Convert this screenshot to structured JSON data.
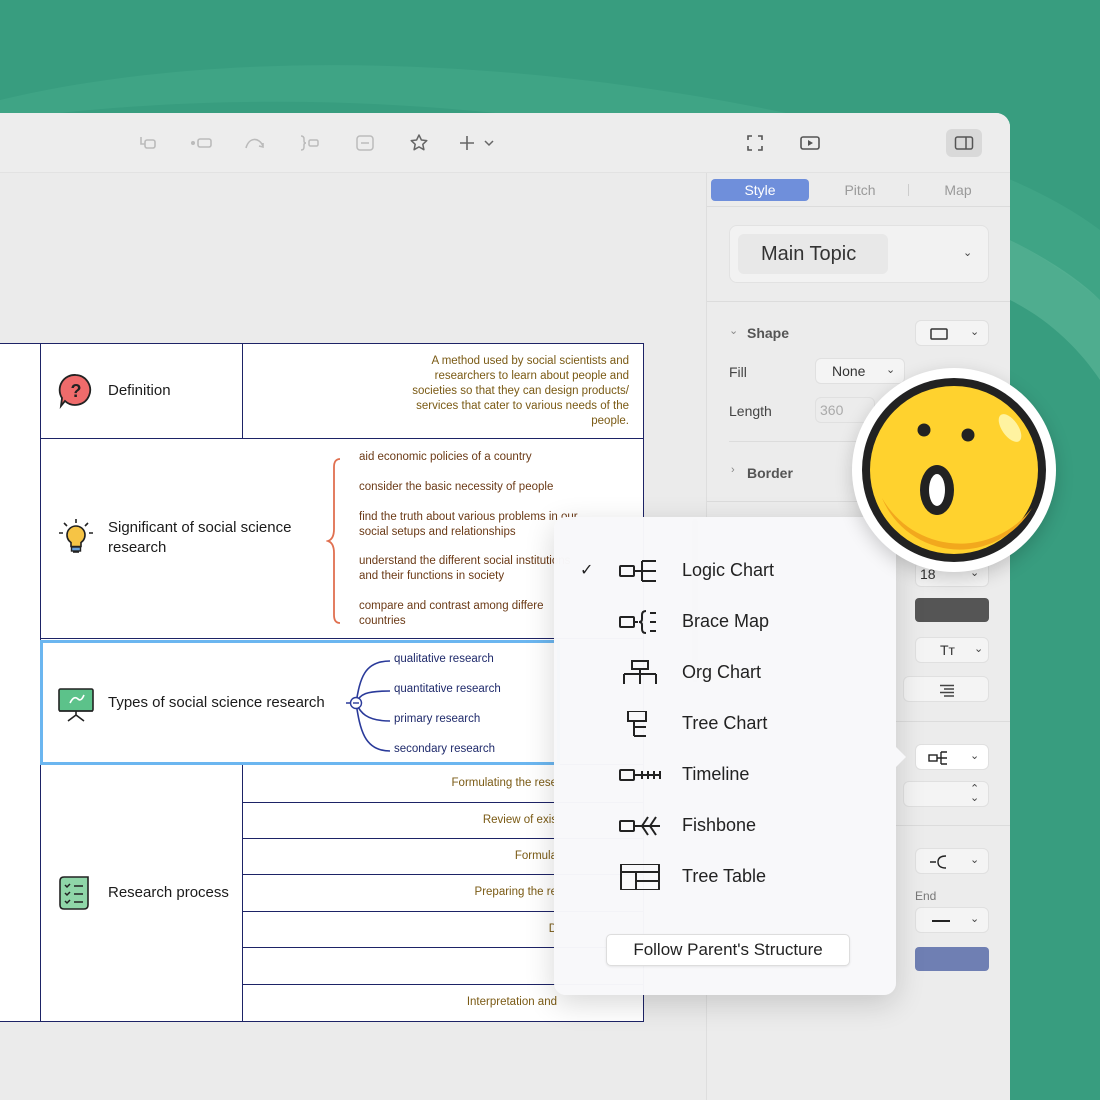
{
  "toolbar": {
    "icons": [
      "topic-icon",
      "subtopic-icon",
      "relationship-icon",
      "summary-icon",
      "boundary-icon",
      "star-icon",
      "add-icon",
      "fullscreen-icon",
      "play-icon",
      "panel-toggle-icon"
    ]
  },
  "table": {
    "rows": [
      {
        "label": "Definition",
        "note": [
          "A method used by social scientists and",
          "researchers to learn about people and",
          "societies so that they can design products/",
          "services that cater to various needs of the",
          "people."
        ]
      },
      {
        "label_lines": [
          "Significant of social science",
          "research"
        ],
        "branches": [
          [
            "aid economic policies of a country"
          ],
          [
            "consider the basic necessity of people"
          ],
          [
            "find the truth about various problems in our",
            "social setups and relationships"
          ],
          [
            "understand the different social institutions",
            "and their functions in society"
          ],
          [
            "compare and contrast among differe",
            "countries"
          ]
        ]
      },
      {
        "label": "Types of social science research",
        "branches": [
          "qualitative research",
          "quantitative research",
          "primary research",
          "secondary research"
        ]
      },
      {
        "label": "Research process",
        "steps": [
          "Formulating the rese",
          "Review of exis",
          "Formula",
          "Preparing the re",
          "D",
          "",
          "Interpretation and"
        ]
      }
    ]
  },
  "panel": {
    "tabs": [
      "Style",
      "Pitch",
      "Map"
    ],
    "topic_select": "Main Topic",
    "shape_label": "Shape",
    "fill_label": "Fill",
    "fill_value": "None",
    "length_label": "Length",
    "length_value": "360",
    "border_label": "Border",
    "font_size": "18",
    "end_label": "End",
    "dark_color": "#555555",
    "line_color": "#6f7fb3"
  },
  "popup": {
    "items": [
      {
        "label": "Logic Chart",
        "checked": "✓"
      },
      {
        "label": "Brace Map",
        "checked": ""
      },
      {
        "label": "Org Chart",
        "checked": ""
      },
      {
        "label": "Tree Chart",
        "checked": ""
      },
      {
        "label": "Timeline",
        "checked": ""
      },
      {
        "label": "Fishbone",
        "checked": ""
      },
      {
        "label": "Tree Table",
        "checked": ""
      }
    ],
    "follow_label": "Follow Parent's Structure"
  },
  "colors": {
    "background": "#389d7f",
    "accent": "#6f8fdb",
    "table_border": "#1d2366",
    "selection": "#6bb6f0",
    "brace": "#e07050"
  }
}
